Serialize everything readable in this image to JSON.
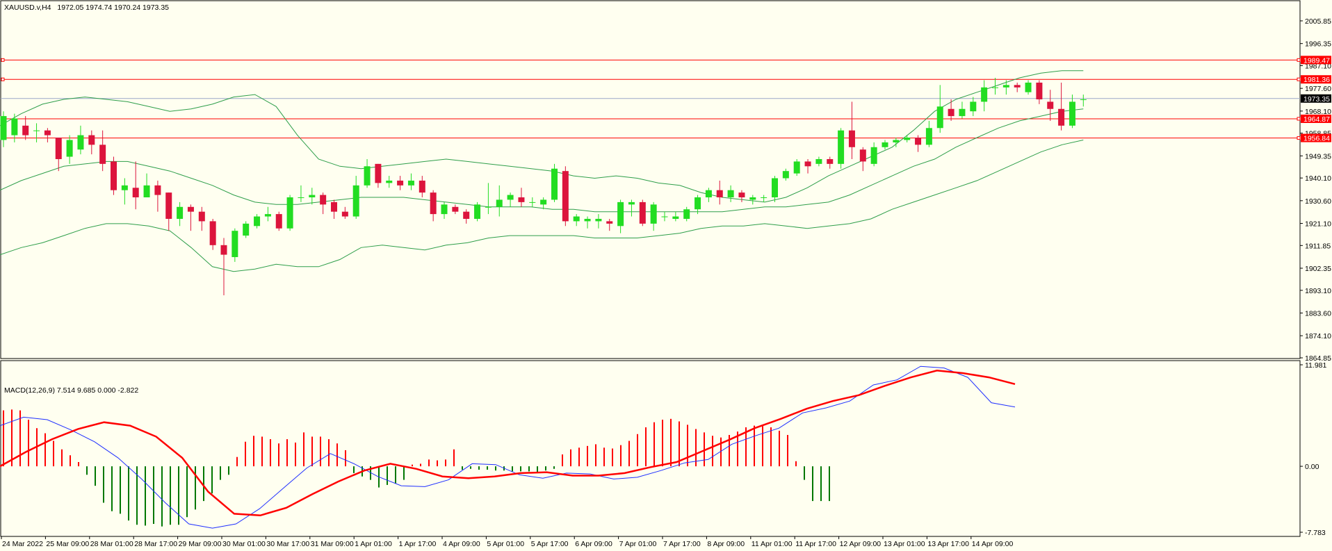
{
  "header": {
    "symbol": "XAUUSD.v,H4",
    "ohlc": "1972.05 1974.74 1970.24 1973.35"
  },
  "macd_header": "MACD(12,26,9) 7.514 9.685 0.000 -2.822",
  "colors": {
    "background": "#fffff0",
    "bull": "#22dd22",
    "bear": "#dc143c",
    "bands": "#2e9e4a",
    "level_line": "#ff0000",
    "current_line": "#9aa7c8",
    "macd_line": "#1f2fff",
    "signal_line": "#ff0000",
    "hist_pos": "#ff0000",
    "hist_neg": "#007700"
  },
  "chart_data": [
    {
      "type": "candlestick",
      "title": "XAUUSD.v,H4",
      "ylim": [
        1864.85,
        2010.5
      ],
      "y_ticks": [
        "2005.85",
        "1996.35",
        "1987.10",
        "1977.60",
        "1968.10",
        "1958.85",
        "1949.35",
        "1940.10",
        "1930.60",
        "1921.10",
        "1911.85",
        "1902.35",
        "1893.10",
        "1883.60",
        "1874.10",
        "1864.85"
      ],
      "x_ticks": [
        "24 Mar 2022",
        "25 Mar 09:00",
        "28 Mar 01:00",
        "28 Mar 17:00",
        "29 Mar 09:00",
        "30 Mar 01:00",
        "30 Mar 17:00",
        "31 Mar 09:00",
        "1 Apr 01:00",
        "1 Apr 17:00",
        "4 Apr 09:00",
        "5 Apr 01:00",
        "5 Apr 17:00",
        "6 Apr 09:00",
        "7 Apr 01:00",
        "7 Apr 17:00",
        "8 Apr 09:00",
        "11 Apr 01:00",
        "11 Apr 17:00",
        "12 Apr 09:00",
        "13 Apr 01:00",
        "13 Apr 17:00",
        "14 Apr 09:00"
      ],
      "current_price": 1973.35,
      "levels": [
        1989.47,
        1981.36,
        1964.87,
        1956.84
      ],
      "level_labels": [
        "1989.47",
        "1981.36",
        "1973.35",
        "1964.87",
        "1956.84"
      ],
      "ohlc": [
        [
          1956,
          1966,
          1953,
          1968
        ],
        [
          1958,
          1965,
          1955,
          1967
        ],
        [
          1962,
          1958,
          1956,
          1966
        ],
        [
          1960,
          1960,
          1955,
          1963
        ],
        [
          1960,
          1958,
          1955,
          1961
        ],
        [
          1957,
          1948,
          1943,
          1957
        ],
        [
          1949,
          1956,
          1946,
          1958
        ],
        [
          1952,
          1958,
          1950,
          1962
        ],
        [
          1958,
          1954,
          1950,
          1960
        ],
        [
          1954,
          1946,
          1943,
          1960
        ],
        [
          1947,
          1935,
          1933,
          1949
        ],
        [
          1935,
          1937,
          1929,
          1940
        ],
        [
          1936,
          1932,
          1927,
          1947
        ],
        [
          1932,
          1937,
          1933,
          1942
        ],
        [
          1937,
          1933,
          1926,
          1939
        ],
        [
          1934,
          1923,
          1918,
          1934
        ],
        [
          1923,
          1928,
          1920,
          1930
        ],
        [
          1928,
          1926,
          1918,
          1929
        ],
        [
          1926,
          1922,
          1918,
          1928
        ],
        [
          1922,
          1912,
          1910,
          1923
        ],
        [
          1912,
          1908,
          1891,
          1915
        ],
        [
          1907,
          1918,
          1905,
          1919
        ],
        [
          1916,
          1921,
          1915,
          1922
        ],
        [
          1920,
          1924,
          1919,
          1925
        ],
        [
          1924,
          1925,
          1922,
          1928
        ],
        [
          1925,
          1919,
          1918,
          1926
        ],
        [
          1919,
          1932,
          1918,
          1933
        ],
        [
          1932,
          1932,
          1930,
          1937
        ],
        [
          1932,
          1933,
          1929,
          1936
        ],
        [
          1933,
          1929,
          1925,
          1934
        ],
        [
          1930,
          1926,
          1923,
          1931
        ],
        [
          1926,
          1924,
          1923,
          1928
        ],
        [
          1924,
          1937,
          1923,
          1941
        ],
        [
          1937,
          1945,
          1936,
          1948
        ],
        [
          1946,
          1938,
          1936,
          1946
        ],
        [
          1938,
          1939,
          1936,
          1941
        ],
        [
          1939,
          1937,
          1935,
          1941
        ],
        [
          1937,
          1939,
          1935,
          1942
        ],
        [
          1939,
          1934,
          1932,
          1941
        ],
        [
          1934,
          1925,
          1922,
          1935
        ],
        [
          1925,
          1929,
          1923,
          1930
        ],
        [
          1928,
          1926,
          1925,
          1929
        ],
        [
          1926,
          1923,
          1921,
          1927
        ],
        [
          1923,
          1929,
          1922,
          1930
        ],
        [
          1928,
          1928,
          1925,
          1938
        ],
        [
          1928,
          1931,
          1924,
          1937
        ],
        [
          1931,
          1933,
          1928,
          1934
        ],
        [
          1932,
          1930,
          1928,
          1936
        ],
        [
          1930,
          1930,
          1928,
          1932
        ],
        [
          1929,
          1931,
          1927,
          1932
        ],
        [
          1931,
          1944,
          1930,
          1946
        ],
        [
          1943,
          1922,
          1920,
          1945
        ],
        [
          1922,
          1924,
          1920,
          1925
        ],
        [
          1922,
          1923,
          1919,
          1924
        ],
        [
          1922,
          1923,
          1919,
          1925
        ],
        [
          1922,
          1921,
          1918,
          1923
        ],
        [
          1920,
          1930,
          1917,
          1931
        ],
        [
          1929,
          1930,
          1924,
          1931
        ],
        [
          1930,
          1921,
          1920,
          1931
        ],
        [
          1921,
          1929,
          1918,
          1930
        ],
        [
          1924,
          1924,
          1922,
          1926
        ],
        [
          1923,
          1924,
          1922,
          1926
        ],
        [
          1923,
          1927,
          1922,
          1928
        ],
        [
          1927,
          1932,
          1925,
          1933
        ],
        [
          1932,
          1935,
          1930,
          1936
        ],
        [
          1935,
          1932,
          1929,
          1939
        ],
        [
          1932,
          1935,
          1930,
          1937
        ],
        [
          1934,
          1932,
          1930,
          1935
        ],
        [
          1931,
          1932,
          1929,
          1933
        ],
        [
          1932,
          1932,
          1930,
          1933
        ],
        [
          1932,
          1940,
          1930,
          1941
        ],
        [
          1940,
          1943,
          1939,
          1944
        ],
        [
          1942,
          1947,
          1941,
          1948
        ],
        [
          1947,
          1945,
          1942,
          1948
        ],
        [
          1946,
          1948,
          1945,
          1949
        ],
        [
          1948,
          1946,
          1944,
          1949
        ],
        [
          1946,
          1960,
          1944,
          1961
        ],
        [
          1960,
          1953,
          1948,
          1972
        ],
        [
          1952,
          1947,
          1943,
          1953
        ],
        [
          1946,
          1953,
          1945,
          1955
        ],
        [
          1953,
          1955,
          1952,
          1956
        ],
        [
          1955,
          1956,
          1953,
          1957
        ],
        [
          1956,
          1957,
          1955,
          1958
        ],
        [
          1957,
          1954,
          1951,
          1958
        ],
        [
          1954,
          1961,
          1953,
          1964
        ],
        [
          1961,
          1970,
          1959,
          1979
        ],
        [
          1969,
          1966,
          1964,
          1973
        ],
        [
          1966,
          1969,
          1965,
          1972
        ],
        [
          1968,
          1972,
          1966,
          1974
        ],
        [
          1972,
          1978,
          1968,
          1981
        ],
        [
          1978,
          1978,
          1975,
          1982
        ],
        [
          1978,
          1979,
          1975,
          1981
        ],
        [
          1979,
          1978,
          1976,
          1980
        ],
        [
          1976,
          1980,
          1975,
          1981
        ],
        [
          1980,
          1973,
          1971,
          1981
        ],
        [
          1972,
          1969,
          1964,
          1977
        ],
        [
          1969,
          1962,
          1960,
          1980
        ],
        [
          1962,
          1972,
          1961,
          1975
        ],
        [
          1973,
          1973,
          1970,
          1975
        ]
      ],
      "bollinger": {
        "upper": [
          1962,
          1967,
          1971,
          1973,
          1974,
          1973,
          1972,
          1970,
          1968,
          1969,
          1971,
          1974,
          1975,
          1970,
          1958,
          1948,
          1945,
          1944,
          1945,
          1946,
          1947,
          1948,
          1947,
          1946,
          1945,
          1944,
          1943,
          1941,
          1940,
          1941,
          1940,
          1938,
          1937,
          1934,
          1932,
          1931,
          1930,
          1932,
          1936,
          1941,
          1945,
          1949,
          1953,
          1960,
          1968,
          1973,
          1976,
          1979,
          1982,
          1984,
          1985,
          1985
        ],
        "middle": [
          1935,
          1939,
          1942,
          1945,
          1946,
          1947,
          1947,
          1945,
          1943,
          1940,
          1937,
          1933,
          1930,
          1929,
          1929,
          1930,
          1931,
          1932,
          1932,
          1932,
          1931,
          1930,
          1929,
          1928,
          1928,
          1928,
          1927,
          1927,
          1926,
          1926,
          1926,
          1926,
          1926,
          1926,
          1926,
          1927,
          1928,
          1928,
          1929,
          1930,
          1933,
          1937,
          1941,
          1945,
          1948,
          1953,
          1957,
          1961,
          1964,
          1966,
          1968,
          1969
        ],
        "lower": [
          1908,
          1911,
          1913,
          1916,
          1919,
          1921,
          1921,
          1920,
          1918,
          1911,
          1903,
          1901,
          1902,
          1904,
          1903,
          1903,
          1906,
          1911,
          1912,
          1911,
          1910,
          1912,
          1913,
          1915,
          1916,
          1916,
          1916,
          1916,
          1915,
          1915,
          1915,
          1916,
          1917,
          1919,
          1920,
          1920,
          1921,
          1920,
          1919,
          1920,
          1921,
          1923,
          1927,
          1930,
          1933,
          1936,
          1939,
          1943,
          1947,
          1951,
          1954,
          1956
        ]
      }
    },
    {
      "type": "line",
      "title": "MACD(12,26,9)",
      "ylim": [
        -7.783,
        11.981
      ],
      "y_ticks": [
        "11.981",
        "0.00",
        "-7.783"
      ],
      "series": [
        {
          "name": "MACD",
          "values": [
            4.8,
            5.8,
            5.5,
            4.3,
            2.9,
            1.0,
            -1.5,
            -4.3,
            -6.8,
            -7.3,
            -6.8,
            -5.0,
            -2.6,
            -0.2,
            1.5,
            0.3,
            -1.2,
            -2.3,
            -2.4,
            -1.6,
            0.3,
            0.2,
            -1.0,
            -1.4,
            -0.8,
            -0.9,
            -1.5,
            -1.3,
            -0.5,
            0.4,
            0.8,
            2.6,
            3.6,
            4.5,
            6.3,
            6.9,
            7.7,
            9.6,
            10.2,
            11.8,
            11.6,
            10.5,
            7.5,
            7.0
          ]
        },
        {
          "name": "Signal",
          "values": [
            0.0,
            1.7,
            3.2,
            4.4,
            5.2,
            4.8,
            3.5,
            1.0,
            -3.0,
            -5.6,
            -5.8,
            -4.9,
            -3.3,
            -1.8,
            -0.5,
            0.3,
            -0.3,
            -1.2,
            -1.4,
            -1.2,
            -0.8,
            -0.7,
            -1.1,
            -1.1,
            -0.8,
            -0.1,
            0.5,
            1.8,
            3.1,
            4.5,
            5.6,
            6.8,
            7.7,
            8.4,
            9.5,
            10.5,
            11.3,
            11.0,
            10.5,
            9.7
          ]
        }
      ],
      "histogram": [
        6.6,
        6.7,
        6.6,
        5.5,
        4.5,
        3.9,
        3.0,
        2.0,
        1.3,
        0.5,
        -1.0,
        -2.3,
        -4.3,
        -5.3,
        -5.6,
        -6.4,
        -6.9,
        -7.0,
        -6.8,
        -7.1,
        -6.9,
        -6.9,
        -6.0,
        -5.1,
        -4.1,
        -3.2,
        -1.6,
        -1.0,
        1.1,
        2.9,
        3.6,
        3.5,
        3.2,
        2.7,
        3.2,
        2.8,
        4.0,
        3.5,
        3.5,
        3.2,
        2.7,
        1.9,
        -0.8,
        -1.2,
        -1.6,
        -2.5,
        -2.2,
        -2.0,
        -1.6,
        0.2,
        0.3,
        0.8,
        0.7,
        0.8,
        2.0,
        -0.4,
        -0.3,
        -0.4,
        -0.4,
        -0.5,
        -0.5,
        -0.6,
        -0.6,
        -0.6,
        -0.7,
        -0.5,
        -0.3,
        1.4,
        2.0,
        2.2,
        2.4,
        2.6,
        2.2,
        2.1,
        2.5,
        3.0,
        3.8,
        4.6,
        5.2,
        5.5,
        5.6,
        5.3,
        4.9,
        4.4,
        4.0,
        3.6,
        3.4,
        3.7,
        4.1,
        4.6,
        4.8,
        4.8,
        4.6,
        4.2,
        3.7,
        0.6,
        -1.6,
        -4.1,
        -4.1,
        -4.1
      ]
    }
  ]
}
